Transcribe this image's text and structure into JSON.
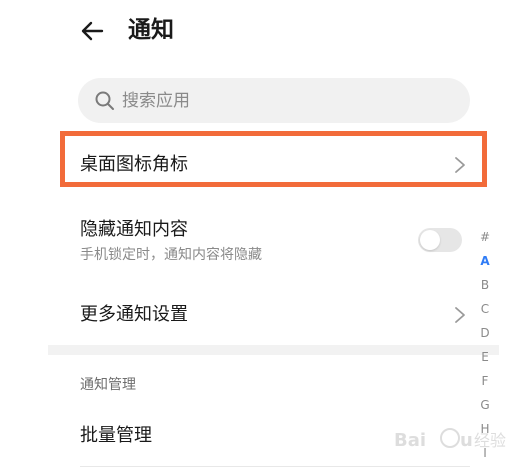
{
  "header": {
    "title": "通知"
  },
  "search": {
    "placeholder": "搜索应用"
  },
  "rows": {
    "badge": {
      "label": "桌面图标角标"
    },
    "hide_content": {
      "label": "隐藏通知内容",
      "sub": "手机锁定时，通知内容将隐藏",
      "toggle_on": false
    },
    "more_settings": {
      "label": "更多通知设置"
    }
  },
  "section": {
    "title": "通知管理"
  },
  "batch": {
    "label": "批量管理"
  },
  "alpha_index": {
    "letters": [
      "#",
      "A",
      "B",
      "C",
      "D",
      "E",
      "F",
      "G",
      "H",
      "I"
    ],
    "active": "A"
  },
  "watermark": {
    "text": "Baidu经验"
  },
  "colors": {
    "highlight": "#f26b3a",
    "accent": "#2f7cf6"
  }
}
